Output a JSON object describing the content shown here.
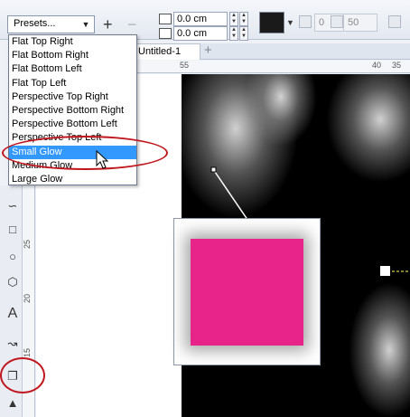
{
  "toolbar": {
    "preset_value": "Presets...",
    "add_label": "+",
    "remove_label": "−",
    "x_value": "0.0 cm",
    "y_value": "0.0 cm",
    "offset_value": "0",
    "opacity_value": "50"
  },
  "document": {
    "tab_title": "Untitled-1",
    "add_tab": "+"
  },
  "ruler_top": [
    "55",
    "40",
    "35"
  ],
  "ruler_left": [
    "25",
    "20",
    "15"
  ],
  "presets_menu": {
    "items": [
      "Flat Top Right",
      "Flat Bottom Right",
      "Flat Bottom Left",
      "Flat Top Left",
      "Perspective Top Right",
      "Perspective Bottom Right",
      "Perspective Bottom Left",
      "Perspective Top Left",
      "Small Glow",
      "Medium Glow",
      "Large Glow"
    ],
    "selected": "Small Glow"
  },
  "colors": {
    "preview_object": "#e8248a",
    "annotation": "#c0161d",
    "selection": "#3399ff",
    "shadow_color": "#1a1a1a"
  },
  "icons": {
    "tools": [
      "freehand-icon",
      "rectangle-icon",
      "ellipse-icon",
      "polygon-icon",
      "text-icon",
      "dimension-icon",
      "drop-shadow-icon",
      "fill-icon"
    ]
  }
}
